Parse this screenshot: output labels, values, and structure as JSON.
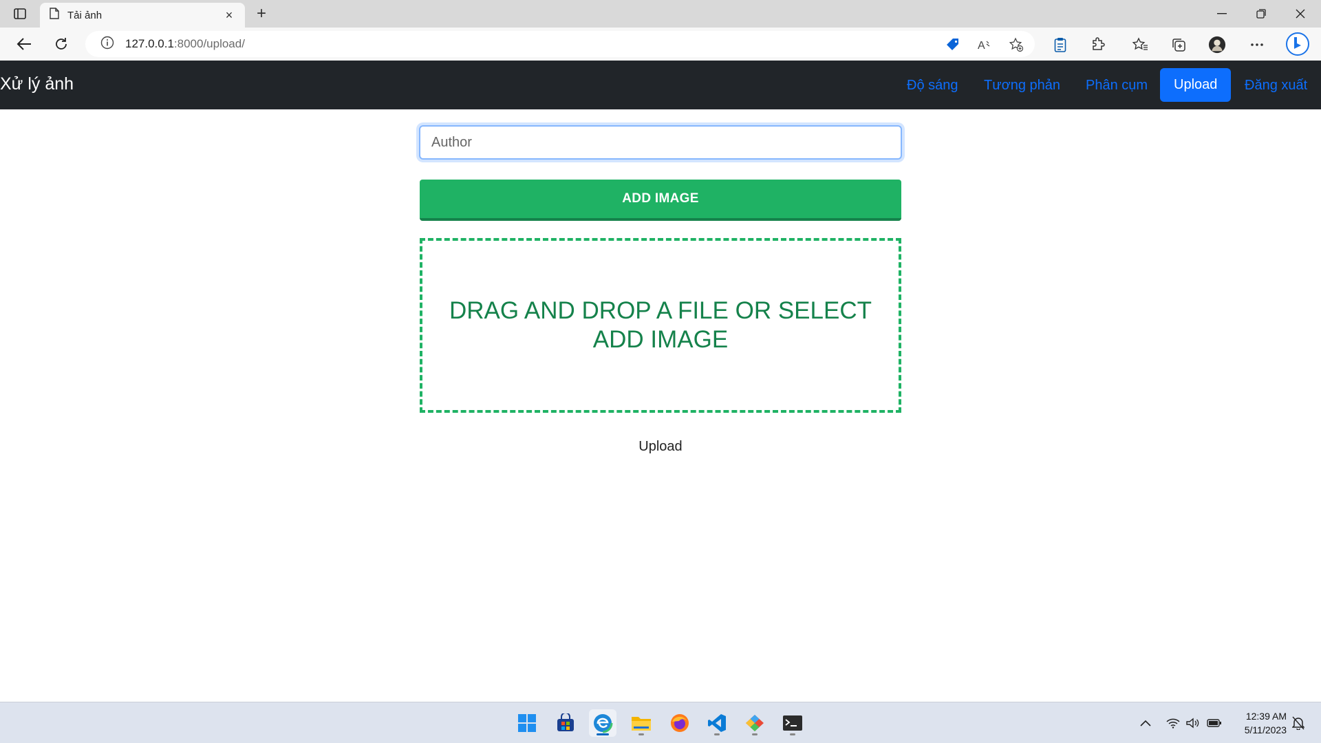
{
  "browser": {
    "tab_title": "Tải ảnh",
    "url_host": "127.0.0.1",
    "url_path": ":8000/upload/"
  },
  "navbar": {
    "brand": "Xử lý ảnh",
    "links": [
      {
        "label": "Độ sáng",
        "active": false
      },
      {
        "label": "Tương phản",
        "active": false
      },
      {
        "label": "Phân cụm",
        "active": false
      },
      {
        "label": "Upload",
        "active": true
      },
      {
        "label": "Đăng xuất",
        "active": false
      }
    ]
  },
  "form": {
    "author_placeholder": "Author",
    "add_image_label": "ADD IMAGE",
    "drop_zone_text": "DRAG AND DROP A FILE OR SELECT ADD IMAGE",
    "upload_label": "Upload"
  },
  "taskbar": {
    "time": "12:39 AM",
    "date": "5/11/2023"
  },
  "colors": {
    "navbar_bg": "#212529",
    "link": "#0d6efd",
    "green": "#1fb264",
    "green_dark": "#15824b"
  }
}
